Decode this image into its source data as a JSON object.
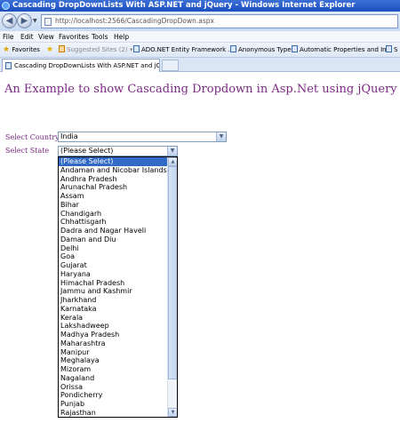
{
  "window": {
    "title": "Cascading DropDownLists With ASP.NET and jQuery - Windows Internet Explorer"
  },
  "address_bar": {
    "url": "http://localhost:2566/CascadingDropDown.aspx"
  },
  "menu": [
    "File",
    "Edit",
    "View",
    "Favorites",
    "Tools",
    "Help"
  ],
  "favorites_bar": {
    "label": "Favorites",
    "suggested": "Suggested Sites (2) ▾",
    "links": [
      "ADO.NET Entity Framework ...",
      "Anonymous Types",
      "Automatic Properties and In...",
      "S"
    ]
  },
  "tabs": [
    {
      "label": "Cascading DropDownLists With ASP.NET and jQuery"
    }
  ],
  "page": {
    "heading": "An Example to show Cascading Dropdown in Asp.Net using jQuery",
    "country_label": "Select Country",
    "country_value": "India",
    "state_label": "Select State",
    "state_value": "(Please Select)",
    "state_options": [
      "(Please Select)",
      "Andaman and Nicobar Islands",
      "Andhra Pradesh",
      "Arunachal Pradesh",
      "Assam",
      "Bihar",
      "Chandigarh",
      "Chhattisgarh",
      "Dadra and Nagar Haveli",
      "Daman and Diu",
      "Delhi",
      "Goa",
      "Gujarat",
      "Haryana",
      "Himachal Pradesh",
      "Jammu and Kashmir",
      "Jharkhand",
      "Karnataka",
      "Kerala",
      "Lakshadweep",
      "Madhya Pradesh",
      "Maharashtra",
      "Manipur",
      "Meghalaya",
      "Mizoram",
      "Nagaland",
      "Orissa",
      "Pondicherry",
      "Punjab",
      "Rajasthan"
    ]
  },
  "colors": {
    "heading": "#7a2a82",
    "selected_option_bg": "#316ac5",
    "titlebar": "#1c4fc0"
  }
}
